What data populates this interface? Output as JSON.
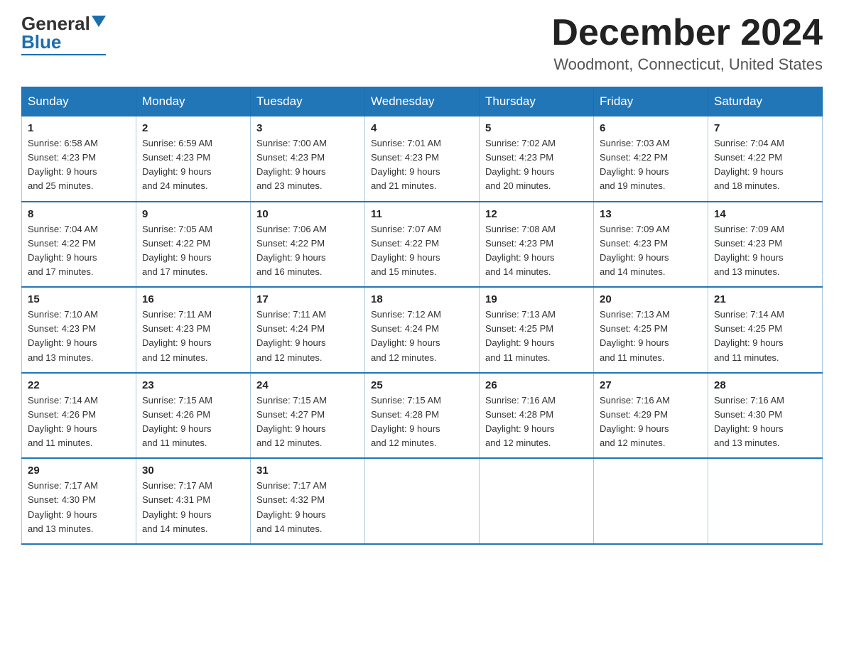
{
  "header": {
    "logo_general": "General",
    "logo_blue": "Blue",
    "month_title": "December 2024",
    "location": "Woodmont, Connecticut, United States"
  },
  "weekdays": [
    "Sunday",
    "Monday",
    "Tuesday",
    "Wednesday",
    "Thursday",
    "Friday",
    "Saturday"
  ],
  "weeks": [
    [
      {
        "day": "1",
        "sunrise": "6:58 AM",
        "sunset": "4:23 PM",
        "daylight": "9 hours and 25 minutes."
      },
      {
        "day": "2",
        "sunrise": "6:59 AM",
        "sunset": "4:23 PM",
        "daylight": "9 hours and 24 minutes."
      },
      {
        "day": "3",
        "sunrise": "7:00 AM",
        "sunset": "4:23 PM",
        "daylight": "9 hours and 23 minutes."
      },
      {
        "day": "4",
        "sunrise": "7:01 AM",
        "sunset": "4:23 PM",
        "daylight": "9 hours and 21 minutes."
      },
      {
        "day": "5",
        "sunrise": "7:02 AM",
        "sunset": "4:23 PM",
        "daylight": "9 hours and 20 minutes."
      },
      {
        "day": "6",
        "sunrise": "7:03 AM",
        "sunset": "4:22 PM",
        "daylight": "9 hours and 19 minutes."
      },
      {
        "day": "7",
        "sunrise": "7:04 AM",
        "sunset": "4:22 PM",
        "daylight": "9 hours and 18 minutes."
      }
    ],
    [
      {
        "day": "8",
        "sunrise": "7:04 AM",
        "sunset": "4:22 PM",
        "daylight": "9 hours and 17 minutes."
      },
      {
        "day": "9",
        "sunrise": "7:05 AM",
        "sunset": "4:22 PM",
        "daylight": "9 hours and 17 minutes."
      },
      {
        "day": "10",
        "sunrise": "7:06 AM",
        "sunset": "4:22 PM",
        "daylight": "9 hours and 16 minutes."
      },
      {
        "day": "11",
        "sunrise": "7:07 AM",
        "sunset": "4:22 PM",
        "daylight": "9 hours and 15 minutes."
      },
      {
        "day": "12",
        "sunrise": "7:08 AM",
        "sunset": "4:23 PM",
        "daylight": "9 hours and 14 minutes."
      },
      {
        "day": "13",
        "sunrise": "7:09 AM",
        "sunset": "4:23 PM",
        "daylight": "9 hours and 14 minutes."
      },
      {
        "day": "14",
        "sunrise": "7:09 AM",
        "sunset": "4:23 PM",
        "daylight": "9 hours and 13 minutes."
      }
    ],
    [
      {
        "day": "15",
        "sunrise": "7:10 AM",
        "sunset": "4:23 PM",
        "daylight": "9 hours and 13 minutes."
      },
      {
        "day": "16",
        "sunrise": "7:11 AM",
        "sunset": "4:23 PM",
        "daylight": "9 hours and 12 minutes."
      },
      {
        "day": "17",
        "sunrise": "7:11 AM",
        "sunset": "4:24 PM",
        "daylight": "9 hours and 12 minutes."
      },
      {
        "day": "18",
        "sunrise": "7:12 AM",
        "sunset": "4:24 PM",
        "daylight": "9 hours and 12 minutes."
      },
      {
        "day": "19",
        "sunrise": "7:13 AM",
        "sunset": "4:25 PM",
        "daylight": "9 hours and 11 minutes."
      },
      {
        "day": "20",
        "sunrise": "7:13 AM",
        "sunset": "4:25 PM",
        "daylight": "9 hours and 11 minutes."
      },
      {
        "day": "21",
        "sunrise": "7:14 AM",
        "sunset": "4:25 PM",
        "daylight": "9 hours and 11 minutes."
      }
    ],
    [
      {
        "day": "22",
        "sunrise": "7:14 AM",
        "sunset": "4:26 PM",
        "daylight": "9 hours and 11 minutes."
      },
      {
        "day": "23",
        "sunrise": "7:15 AM",
        "sunset": "4:26 PM",
        "daylight": "9 hours and 11 minutes."
      },
      {
        "day": "24",
        "sunrise": "7:15 AM",
        "sunset": "4:27 PM",
        "daylight": "9 hours and 12 minutes."
      },
      {
        "day": "25",
        "sunrise": "7:15 AM",
        "sunset": "4:28 PM",
        "daylight": "9 hours and 12 minutes."
      },
      {
        "day": "26",
        "sunrise": "7:16 AM",
        "sunset": "4:28 PM",
        "daylight": "9 hours and 12 minutes."
      },
      {
        "day": "27",
        "sunrise": "7:16 AM",
        "sunset": "4:29 PM",
        "daylight": "9 hours and 12 minutes."
      },
      {
        "day": "28",
        "sunrise": "7:16 AM",
        "sunset": "4:30 PM",
        "daylight": "9 hours and 13 minutes."
      }
    ],
    [
      {
        "day": "29",
        "sunrise": "7:17 AM",
        "sunset": "4:30 PM",
        "daylight": "9 hours and 13 minutes."
      },
      {
        "day": "30",
        "sunrise": "7:17 AM",
        "sunset": "4:31 PM",
        "daylight": "9 hours and 14 minutes."
      },
      {
        "day": "31",
        "sunrise": "7:17 AM",
        "sunset": "4:32 PM",
        "daylight": "9 hours and 14 minutes."
      },
      null,
      null,
      null,
      null
    ]
  ],
  "labels": {
    "sunrise_prefix": "Sunrise: ",
    "sunset_prefix": "Sunset: ",
    "daylight_prefix": "Daylight: "
  }
}
